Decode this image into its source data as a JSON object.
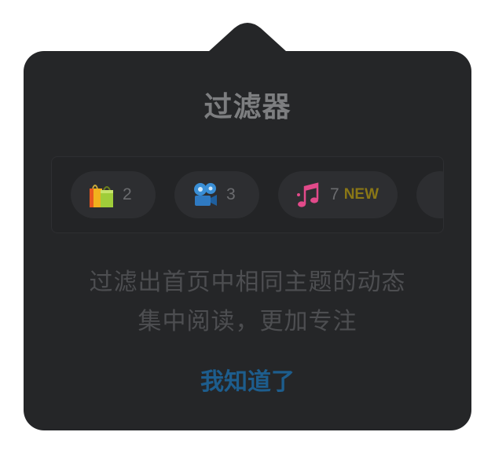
{
  "popover": {
    "title": "过滤器",
    "chips": [
      {
        "icon": "shopping-bags-icon",
        "count": "2"
      },
      {
        "icon": "movie-camera-icon",
        "count": "3"
      },
      {
        "icon": "music-notes-icon",
        "count": "7",
        "badge": "NEW"
      },
      {
        "icon": "partial-chip"
      }
    ],
    "description": {
      "line1": "过滤出首页中相同主题的动态",
      "line2": "集中阅读，更加专注"
    },
    "acknowledge_label": "我知道了"
  },
  "colors": {
    "background": "#252628",
    "chip_background": "#2d2e31",
    "title": "#7d7e80",
    "description": "#4d4e51",
    "count": "#6b6c6f",
    "badge": "#8a7716",
    "acknowledge": "#1d5d8d"
  }
}
